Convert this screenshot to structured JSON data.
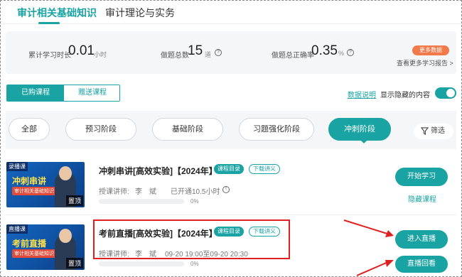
{
  "top_tabs": [
    {
      "label": "审计相关基础知识",
      "active": true
    },
    {
      "label": "审计理论与实务",
      "active": false
    }
  ],
  "stats": {
    "study_time_label": "累计学习时长",
    "study_time_value": "0.01",
    "study_time_unit": "小时",
    "questions_label": "做题总数",
    "questions_value": "15",
    "questions_unit": "道",
    "accuracy_label": "做题总正确率",
    "accuracy_value": "0.35",
    "accuracy_unit": "%",
    "more_data": "更多数据",
    "more_report": "查看更多学习报告 >"
  },
  "course_tabs": [
    {
      "label": "已购课程",
      "active": true
    },
    {
      "label": "赠送课程",
      "active": false
    }
  ],
  "data_explain": "数据说明",
  "show_hidden": "显示隐藏的内容",
  "stages": [
    {
      "label": "全部",
      "active": false
    },
    {
      "label": "预习阶段",
      "active": false
    },
    {
      "label": "基础阶段",
      "active": false
    },
    {
      "label": "习题强化阶段",
      "active": false
    },
    {
      "label": "冲刺阶段",
      "active": true
    }
  ],
  "filter_label": "筛选",
  "courses": [
    {
      "thumb_tag": "录播课",
      "thumb_title": "冲刺串讲",
      "thumb_sub": "审计相关基础知识",
      "pin": "置顶",
      "title": "冲刺串讲[高效实验]【2024年】",
      "badge_catalog": "课程目录",
      "badge_download": "下载讲义",
      "teacher_label": "授课讲师:",
      "teacher": "李　斌",
      "extra": "已开通10.5小时",
      "progress": 0,
      "progress_text": "0%",
      "button": "开始学习",
      "hide": "隐藏课程"
    },
    {
      "thumb_tag": "直播课",
      "thumb_title": "考前直播",
      "thumb_sub": "审计相关基础知识",
      "pin": "置顶",
      "title": "考前直播[高效实验]【2024年】",
      "badge_catalog": "课程目录",
      "badge_download": "下载讲义",
      "teacher_label": "授课讲师:",
      "teacher": "李　斌",
      "extra": "09-20 19:00至09-20 20:30",
      "progress": 0,
      "progress_text": "0%",
      "button": "进入直播",
      "button2": "直播回看"
    }
  ],
  "colors": {
    "accent": "#19a3a3",
    "orange": "#f27a4a",
    "highlight": "#e02020"
  }
}
